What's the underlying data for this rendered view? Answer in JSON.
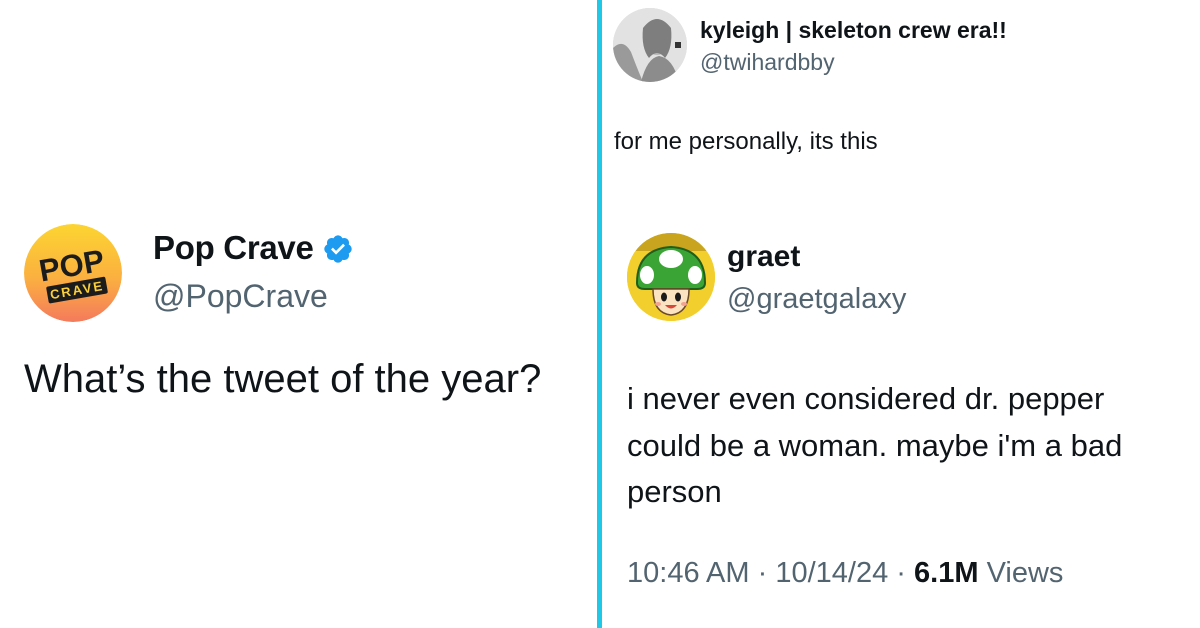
{
  "left_tweet": {
    "author_name": "Pop Crave",
    "author_handle": "@PopCrave",
    "avatar_text_top": "POP",
    "avatar_text_bottom": "CRAVE",
    "text": "What’s the tweet of the year?",
    "verified_color": "#1d9bf0"
  },
  "right_tweet": {
    "author_name": "kyleigh | skeleton crew era!!",
    "author_handle": "@twihardbby",
    "text": "for me personally, its this"
  },
  "quoted_tweet": {
    "author_name": "graet",
    "author_handle": "@graetgalaxy",
    "text": "i never even considered dr. pepper could be a woman. maybe i'm a bad person",
    "time": "10:46 AM",
    "date": "10/14/24",
    "separator": "·",
    "views_count": "6.1M",
    "views_label": "Views"
  },
  "colors": {
    "divider": "#1fc8e6",
    "secondary_text": "#536471",
    "primary_text": "#0f1419"
  }
}
